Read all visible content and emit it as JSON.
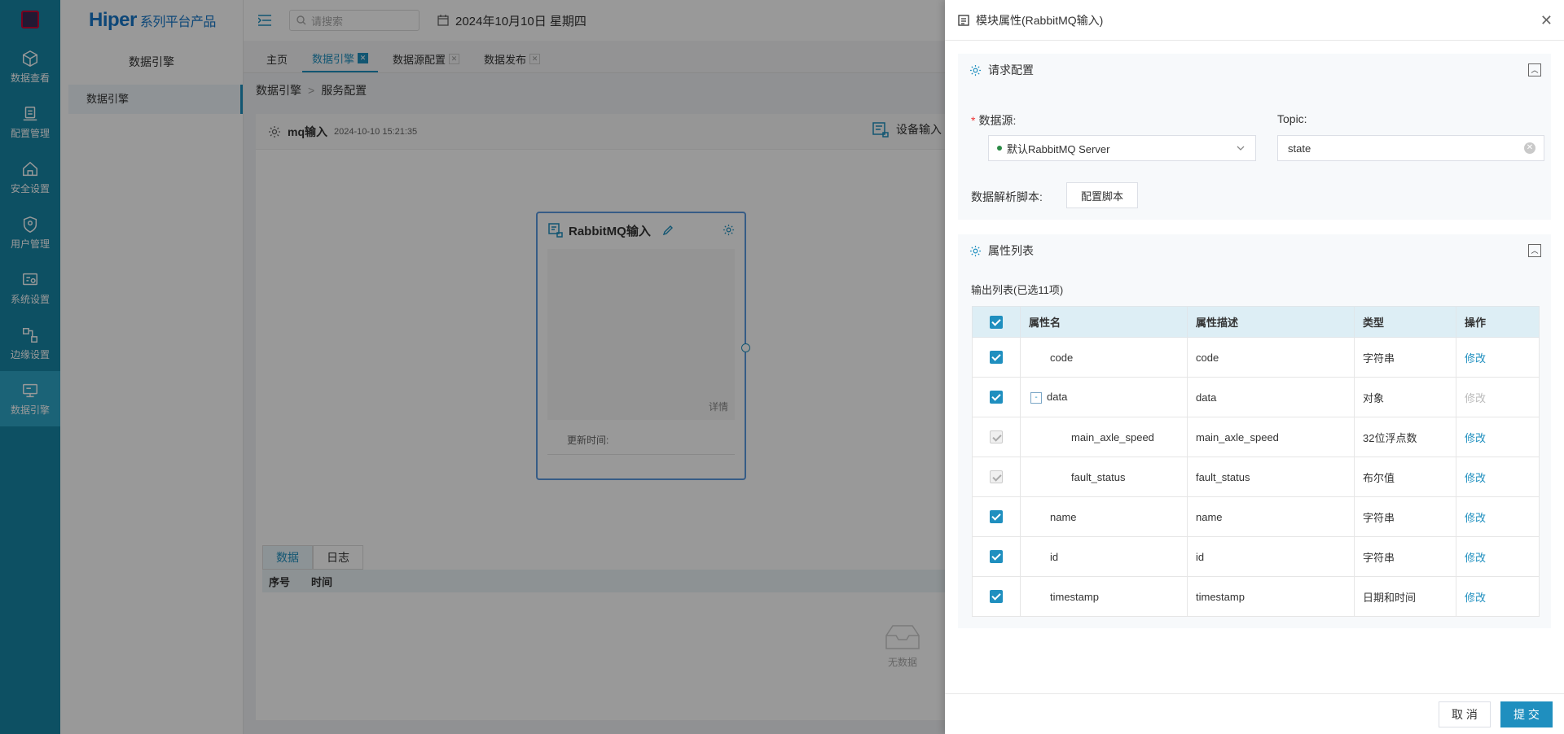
{
  "rail": {
    "items": [
      {
        "label": "数据查看",
        "icon": "cube-icon"
      },
      {
        "label": "配置管理",
        "icon": "config-icon"
      },
      {
        "label": "安全设置",
        "icon": "home-shield-icon"
      },
      {
        "label": "用户管理",
        "icon": "user-shield-icon"
      },
      {
        "label": "系统设置",
        "icon": "system-settings-icon"
      },
      {
        "label": "边缘设置",
        "icon": "edge-icon"
      },
      {
        "label": "数据引擎",
        "icon": "data-engine-icon"
      }
    ]
  },
  "sidebar": {
    "brand": "Hiper",
    "brand_suffix": "系列平台产品",
    "title": "数据引擎",
    "nav_item": "数据引擎"
  },
  "topbar": {
    "search_placeholder": "请搜索",
    "date": "2024年10月10日 星期四"
  },
  "tabs": [
    {
      "label": "主页"
    },
    {
      "label": "数据引擎"
    },
    {
      "label": "数据源配置"
    },
    {
      "label": "数据发布"
    }
  ],
  "breadcrumb": {
    "root": "数据引擎",
    "sep": ">",
    "current": "服务配置"
  },
  "panel": {
    "title": "mq输入",
    "timestamp": "2024-10-10 15:21:35",
    "device_input": "设备输入"
  },
  "card": {
    "title": "RabbitMQ输入",
    "detail": "详情",
    "update_label": "更新时间:"
  },
  "bottom": {
    "tabs": [
      "数据",
      "日志"
    ],
    "columns": [
      "序号",
      "时间"
    ],
    "empty": "无数据"
  },
  "drawer": {
    "title": "模块属性(RabbitMQ输入)",
    "section_request": "请求配置",
    "datasource_label": "数据源:",
    "datasource_value": "默认RabbitMQ Server",
    "topic_label": "Topic:",
    "topic_value": "state",
    "script_label": "数据解析脚本:",
    "script_button": "配置脚本",
    "section_attrs": "属性列表",
    "output_label": "输出列表(已选11项)",
    "columns": {
      "name": "属性名",
      "desc": "属性描述",
      "type": "类型",
      "op": "操作"
    },
    "rows": [
      {
        "name": "code",
        "desc": "code",
        "type": "字符串",
        "op": "修改"
      },
      {
        "name": "data",
        "desc": "data",
        "type": "对象",
        "op": "修改"
      },
      {
        "name": "main_axle_speed",
        "desc": "main_axle_speed",
        "type": "32位浮点数",
        "op": "修改"
      },
      {
        "name": "fault_status",
        "desc": "fault_status",
        "type": "布尔值",
        "op": "修改"
      },
      {
        "name": "name",
        "desc": "name",
        "type": "字符串",
        "op": "修改"
      },
      {
        "name": "id",
        "desc": "id",
        "type": "字符串",
        "op": "修改"
      },
      {
        "name": "timestamp",
        "desc": "timestamp",
        "type": "日期和时间",
        "op": "修改"
      }
    ],
    "cancel": "取 消",
    "submit": "提 交"
  },
  "colors": {
    "accent": "#1f8fbf",
    "rail": "#1685a6"
  }
}
